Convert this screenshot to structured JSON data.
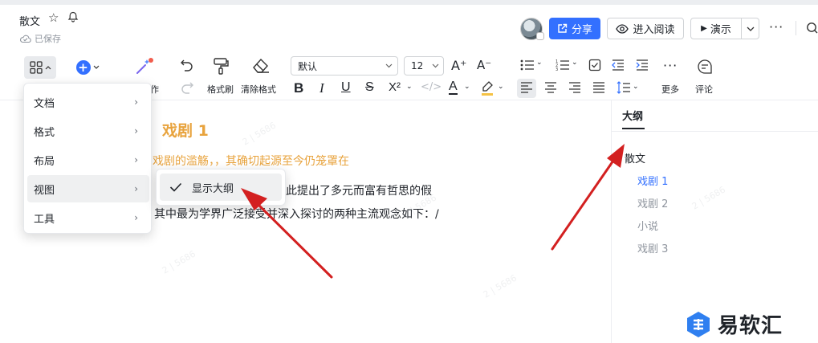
{
  "header": {
    "doc_title": "散文",
    "save_status": "已保存",
    "share_label": "分享",
    "read_mode_label": "进入阅读",
    "present_label": "演示",
    "more_label": "···"
  },
  "toolbar": {
    "format_painter_label": "格式刷",
    "clear_format_label": "清除格式",
    "partial_label": "作",
    "font_family": "默认",
    "font_size": "12",
    "more_label": "更多",
    "comment_label": "评论",
    "superscript_label": "X²",
    "text_color_label": "A"
  },
  "menu": {
    "items": [
      {
        "label": "文档"
      },
      {
        "label": "格式"
      },
      {
        "label": "布局"
      },
      {
        "label": "视图"
      },
      {
        "label": "工具"
      }
    ],
    "submenu": {
      "label": "显示大纲"
    }
  },
  "document": {
    "heading": "戏剧 1",
    "orange_line": "戏剧的滥觞，，其确切起源至今仍笼罩在",
    "line1": "术界对此提出了多元而富有哲思的假",
    "line2": "其中最为学界广泛接受并深入探讨的两种主流观念如下：/"
  },
  "outline": {
    "tab_label": "大纲",
    "items": [
      {
        "label": "散文",
        "level": 1
      },
      {
        "label": "戏剧 1",
        "level": 2,
        "active": true
      },
      {
        "label": "戏剧 2",
        "level": 2
      },
      {
        "label": "小说",
        "level": 2
      },
      {
        "label": "戏剧 3",
        "level": 2
      }
    ]
  },
  "brand": {
    "name": "易软汇"
  },
  "colors": {
    "accent": "#3370ff",
    "heading_orange": "#e8a33d",
    "arrow_red": "#d32020"
  }
}
